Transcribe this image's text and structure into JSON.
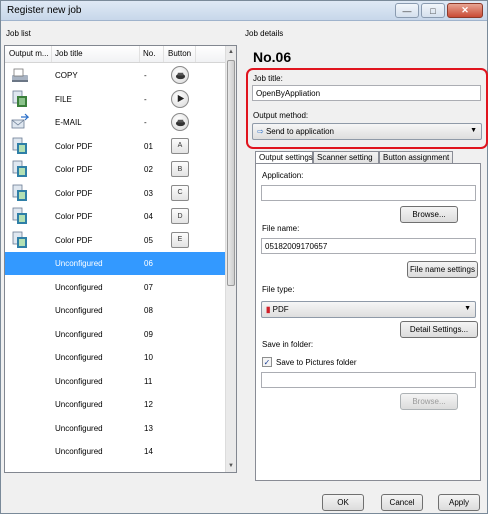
{
  "window": {
    "title": "Register new job",
    "controls": [
      "minimize",
      "maximize",
      "close"
    ]
  },
  "left": {
    "label": "Job list",
    "columns": [
      "Output m...",
      "Job title",
      "No.",
      "Button"
    ],
    "rows": [
      {
        "icon": "copy-icon",
        "title": "COPY",
        "no": "-",
        "button": "scanner-button-icon"
      },
      {
        "icon": "file-icon",
        "title": "FILE",
        "no": "-",
        "button": "stop-button-icon"
      },
      {
        "icon": "email-icon",
        "title": "E-MAIL",
        "no": "-",
        "button": "scanner-button-icon"
      },
      {
        "icon": "color-pdf-icon",
        "title": "Color PDF",
        "no": "01",
        "button": "A"
      },
      {
        "icon": "color-pdf-icon",
        "title": "Color PDF",
        "no": "02",
        "button": "B"
      },
      {
        "icon": "color-pdf-icon",
        "title": "Color PDF",
        "no": "03",
        "button": "C"
      },
      {
        "icon": "color-pdf-icon",
        "title": "Color PDF",
        "no": "04",
        "button": "D"
      },
      {
        "icon": "color-pdf-icon",
        "title": "Color PDF",
        "no": "05",
        "button": "E"
      },
      {
        "icon": "",
        "title": "Unconfigured",
        "no": "06",
        "button": "",
        "selected": true
      },
      {
        "icon": "",
        "title": "Unconfigured",
        "no": "07",
        "button": ""
      },
      {
        "icon": "",
        "title": "Unconfigured",
        "no": "08",
        "button": ""
      },
      {
        "icon": "",
        "title": "Unconfigured",
        "no": "09",
        "button": ""
      },
      {
        "icon": "",
        "title": "Unconfigured",
        "no": "10",
        "button": ""
      },
      {
        "icon": "",
        "title": "Unconfigured",
        "no": "11",
        "button": ""
      },
      {
        "icon": "",
        "title": "Unconfigured",
        "no": "12",
        "button": ""
      },
      {
        "icon": "",
        "title": "Unconfigured",
        "no": "13",
        "button": ""
      },
      {
        "icon": "",
        "title": "Unconfigured",
        "no": "14",
        "button": ""
      }
    ]
  },
  "right": {
    "label": "Job details",
    "job_number": "No.06",
    "job_title_label": "Job title:",
    "job_title_value": "OpenByAppliation",
    "output_method_label": "Output method:",
    "output_method_value": "Send to application",
    "tabs": [
      "Output settings",
      "Scanner setting",
      "Button assignment"
    ],
    "application_label": "Application:",
    "application_value": "",
    "browse_label": "Browse...",
    "file_name_label": "File name:",
    "file_name_value": "05182009170657",
    "file_name_settings_label": "File name settings",
    "file_type_label": "File type:",
    "file_type_value": "PDF",
    "detail_settings_label": "Detail Settings...",
    "save_in_folder_label": "Save in folder:",
    "save_to_pictures_label": "Save to Pictures folder",
    "save_to_pictures_checked": true,
    "folder_value": "",
    "browse_disabled_label": "Browse..."
  },
  "footer": {
    "ok_label": "OK",
    "cancel_label": "Cancel",
    "apply_label": "Apply"
  },
  "colors": {
    "selection": "#3399ff",
    "highlight_border": "#e0141e"
  }
}
